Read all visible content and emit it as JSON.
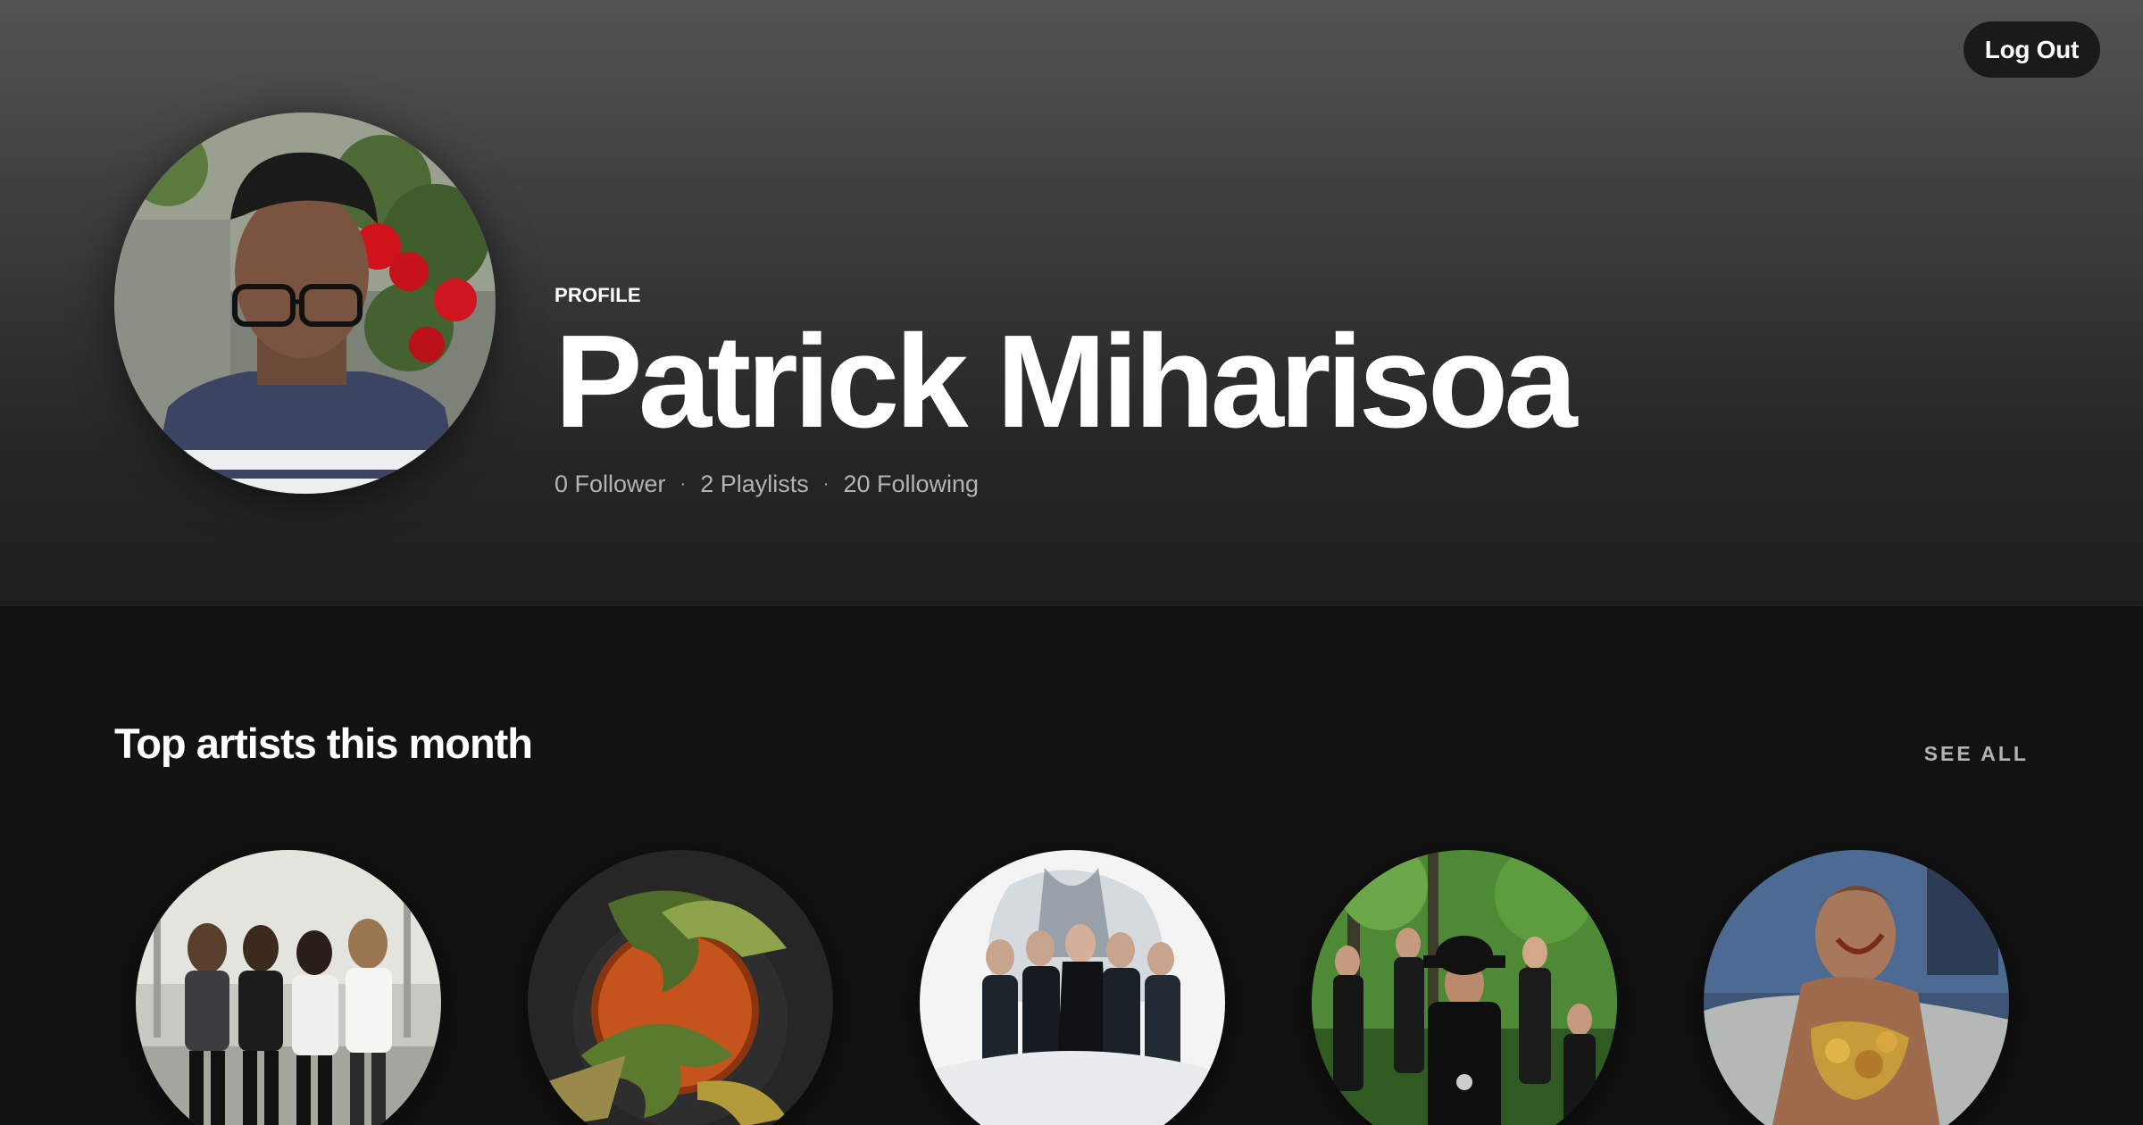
{
  "header": {
    "logout_label": "Log Out"
  },
  "profile": {
    "label": "PROFILE",
    "name": "Patrick Miharisoa",
    "stats": {
      "followers": "0 Follower",
      "playlists": "2 Playlists",
      "following": "20 Following",
      "separator": "·"
    }
  },
  "top_artists": {
    "title": "Top artists this month",
    "see_all_label": "SEE ALL",
    "items": [
      {
        "icon": "band-photo-icon"
      },
      {
        "icon": "bird-artwork-icon"
      },
      {
        "icon": "band-white-photo-icon"
      },
      {
        "icon": "band-forest-photo-icon"
      },
      {
        "icon": "painting-artwork-icon"
      }
    ]
  }
}
